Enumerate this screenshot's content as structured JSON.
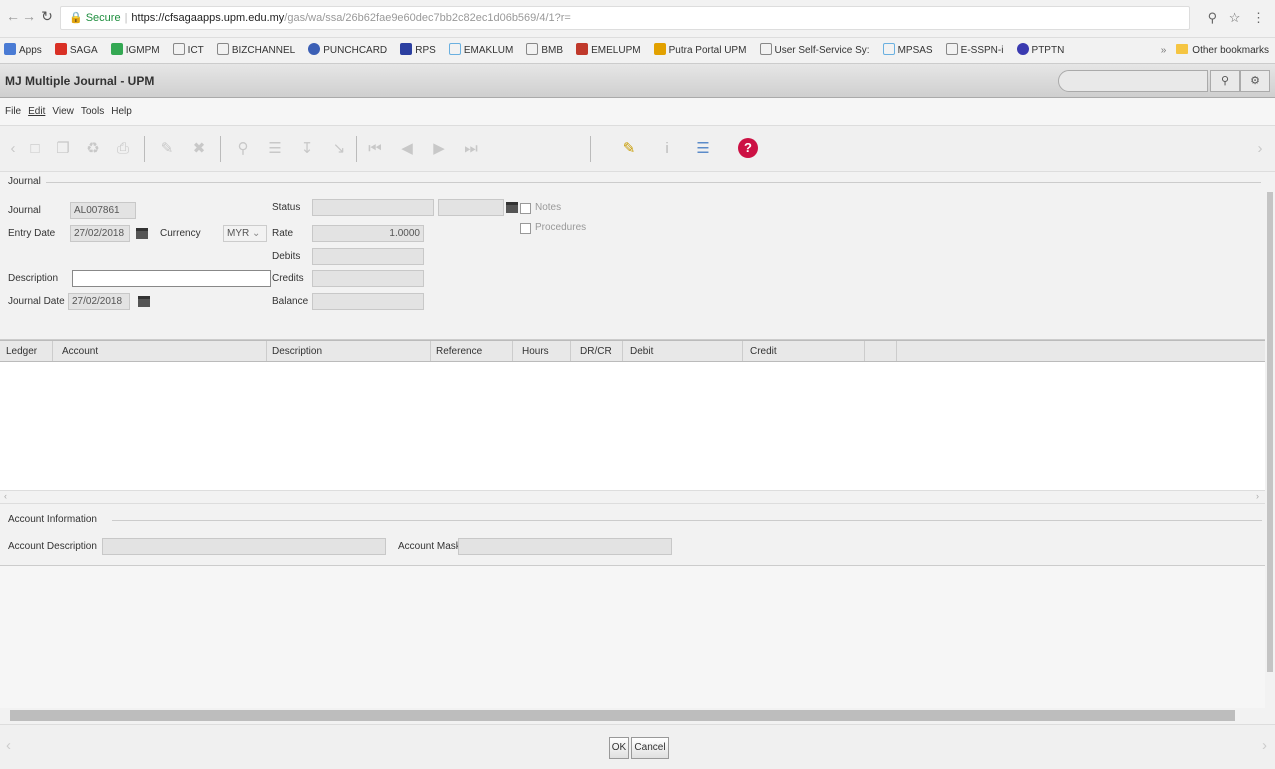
{
  "browser": {
    "secure_label": "Secure",
    "url_host": "https://cfsagaapps.upm.edu.my",
    "url_path": "/gas/wa/ssa/26b62fae9e60dec7bb2c82ec1d06b569/4/1?r=",
    "bookmarks": [
      "Apps",
      "SAGA",
      "IGMPM",
      "ICT",
      "BIZCHANNEL",
      "PUNCHCARD",
      "RPS",
      "EMAKLUM",
      "BMB",
      "EMELUPM",
      "Putra Portal UPM",
      "User Self-Service Sy:",
      "MPSAS",
      "E-SSPN-i",
      "PTPTN"
    ],
    "other_bookmarks": "Other bookmarks"
  },
  "app": {
    "title": "MJ Multiple Journal - UPM"
  },
  "menu": [
    "File",
    "Edit",
    "View",
    "Tools",
    "Help"
  ],
  "journal": {
    "section_label": "Journal",
    "journal_label": "Journal",
    "journal_value": "AL007861",
    "entry_date_label": "Entry Date",
    "entry_date_value": "27/02/2018",
    "currency_label": "Currency",
    "currency_value": "MYR",
    "description_label": "Description",
    "description_value": "",
    "journal_date_label": "Journal Date",
    "journal_date_value": "27/02/2018",
    "status_label": "Status",
    "rate_label": "Rate",
    "rate_value": "1.0000",
    "debits_label": "Debits",
    "credits_label": "Credits",
    "balance_label": "Balance",
    "notes_label": "Notes",
    "procedures_label": "Procedures"
  },
  "grid": {
    "columns": [
      "Ledger",
      "Account",
      "Description",
      "Reference",
      "Hours",
      "DR/CR",
      "Debit",
      "Credit"
    ]
  },
  "account_info": {
    "section_label": "Account Information",
    "account_description_label": "Account Description",
    "account_mask_label": "Account Mask"
  },
  "footer": {
    "ok_label": "OK",
    "cancel_label": "Cancel"
  },
  "colors": {
    "help_icon": "#cc1144",
    "secure": "#1e8e3e"
  }
}
